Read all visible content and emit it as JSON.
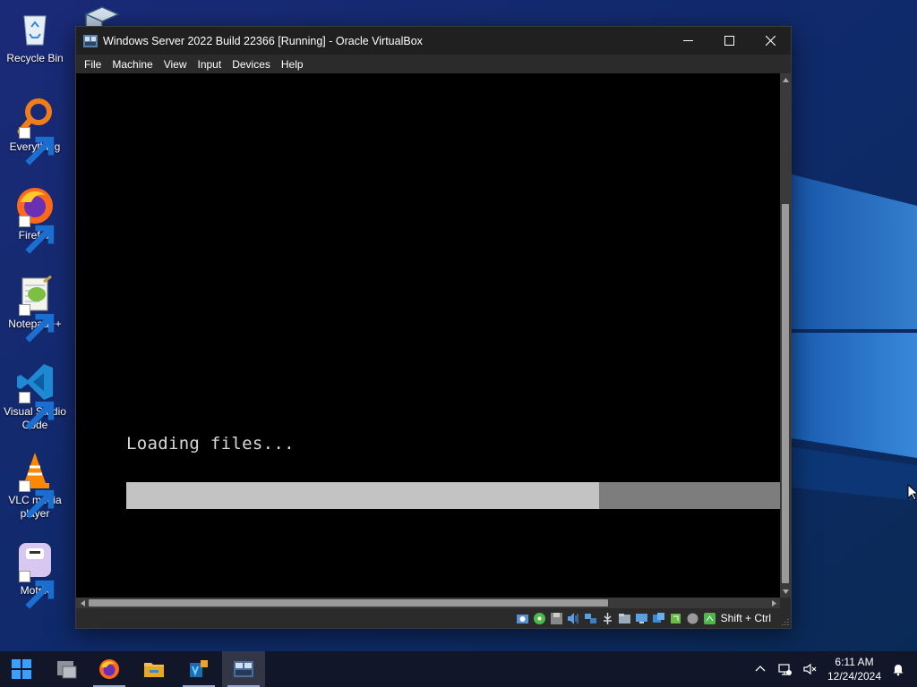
{
  "desktop": {
    "icons": [
      {
        "label": "Recycle Bin",
        "icon": "recycle-bin-icon"
      },
      {
        "label": "Everything",
        "icon": "everything-search-icon"
      },
      {
        "label": "Firefox",
        "icon": "firefox-icon"
      },
      {
        "label": "Notepad++",
        "icon": "notepad-plus-plus-icon"
      },
      {
        "label": "Visual Studio Code",
        "icon": "vscode-icon"
      },
      {
        "label": "VLC media player",
        "icon": "vlc-icon"
      },
      {
        "label": "Motrix",
        "icon": "motrix-icon"
      }
    ]
  },
  "window": {
    "title": "Windows Server 2022 Build 22366 [Running] - Oracle VirtualBox",
    "menu": [
      "File",
      "Machine",
      "View",
      "Input",
      "Devices",
      "Help"
    ],
    "guest": {
      "loading_text": "Loading files...",
      "progress_fraction": 0.723
    },
    "statusbar": {
      "indicators": [
        "hard-disk-icon",
        "optical-drive-icon",
        "floppy-icon",
        "audio-icon",
        "network-icon",
        "usb-icon",
        "shared-folders-icon",
        "display-icon",
        "video-capture-icon",
        "mouse-integration-icon",
        "recording-icon",
        "host-key-indicator-icon"
      ],
      "host_key": "Shift + Ctrl"
    }
  },
  "taskbar": {
    "apps": [
      {
        "name": "start-button",
        "icon": "windows-logo-icon"
      },
      {
        "name": "taskbar-unknown-app",
        "icon": "app-window-icon"
      },
      {
        "name": "taskbar-firefox",
        "icon": "firefox-icon"
      },
      {
        "name": "taskbar-file-explorer",
        "icon": "folder-icon"
      },
      {
        "name": "taskbar-virtualbox-manager",
        "icon": "virtualbox-icon"
      },
      {
        "name": "taskbar-vm-window",
        "icon": "windows-server-2022-icon"
      }
    ],
    "tray": [
      "chevron-up-icon",
      "network-icon",
      "volume-muted-icon"
    ],
    "clock": {
      "time": "6:11 AM",
      "date": "12/24/2024"
    },
    "notification_icon": "notification-icon"
  },
  "colors": {
    "titlebar": "#202020",
    "window_chrome": "#2b2b2b",
    "progress_fill": "#c3c3c3",
    "progress_track": "#7d7d7d",
    "guest_text": "#d8d8d8",
    "wallpaper_dark": "#0b1a3d",
    "wallpaper_light": "#2e7fd6"
  }
}
